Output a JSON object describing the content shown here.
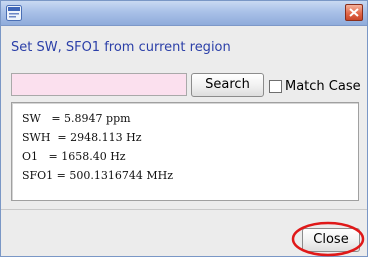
{
  "window": {
    "title": "",
    "heading": "Set SW, SFO1 from current region"
  },
  "search": {
    "value": "",
    "button_label": "Search",
    "match_case_label": "Match Case",
    "match_case_checked": false
  },
  "parameters": [
    "SW   = 5.8947 ppm",
    "SWH  = 2948.113 Hz",
    "O1   = 1658.40 Hz",
    "SFO1 = 500.1316744 MHz"
  ],
  "footer": {
    "close_label": "Close"
  },
  "icons": {
    "app": "app-icon",
    "window_close": "close-icon"
  },
  "colors": {
    "title_bar": "#a9c1e8",
    "heading_text": "#2b3fa8",
    "search_field_bg": "#fbe0ee",
    "window_close": "#e2684a",
    "annotation": "#e01818"
  }
}
